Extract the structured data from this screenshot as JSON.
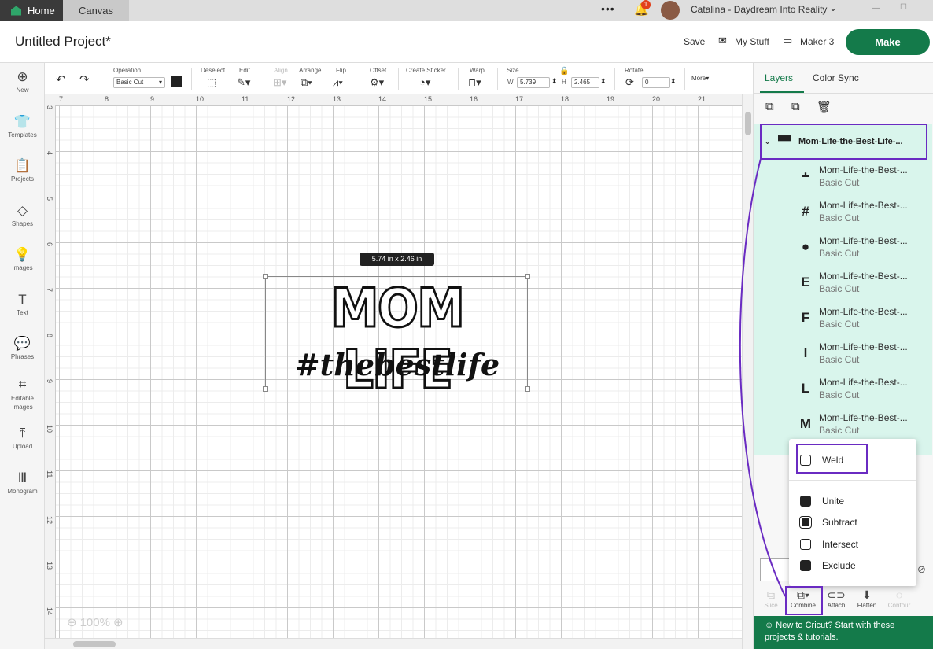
{
  "titlebar": {
    "home_tab": "Home",
    "canvas_tab": "Canvas",
    "more": "•••",
    "notification_count": "1",
    "user_name": "Catalina - Daydream Into Reality"
  },
  "header": {
    "project_title": "Untitled Project*",
    "save": "Save",
    "my_stuff": "My Stuff",
    "machine": "Maker 3",
    "make": "Make"
  },
  "leftbar": [
    {
      "label": "New",
      "icon": "plus-circle-icon"
    },
    {
      "label": "Templates",
      "icon": "shirt-icon"
    },
    {
      "label": "Projects",
      "icon": "clipboard-icon"
    },
    {
      "label": "Shapes",
      "icon": "shapes-icon"
    },
    {
      "label": "Images",
      "icon": "bulb-icon"
    },
    {
      "label": "Text",
      "icon": "text-icon"
    },
    {
      "label": "Phrases",
      "icon": "chat-icon"
    },
    {
      "label": "Editable\nImages",
      "icon": "editable-icon"
    },
    {
      "label": "Upload",
      "icon": "upload-icon"
    },
    {
      "label": "Monogram",
      "icon": "monogram-icon"
    }
  ],
  "toolbar": {
    "operation_label": "Operation",
    "operation_value": "Basic Cut",
    "deselect": "Deselect",
    "edit": "Edit",
    "align": "Align",
    "arrange": "Arrange",
    "flip": "Flip",
    "offset": "Offset",
    "create_sticker": "Create Sticker",
    "warp": "Warp",
    "size": "Size",
    "w_label": "W",
    "w_value": "5.739",
    "h_label": "H",
    "h_value": "2.465",
    "rotate": "Rotate",
    "rotate_value": "0",
    "more": "More"
  },
  "ruler": {
    "top": [
      "7",
      "8",
      "9",
      "10",
      "11",
      "12",
      "13",
      "14",
      "15",
      "16",
      "17",
      "18",
      "19",
      "20",
      "21"
    ],
    "left": [
      "3",
      "4",
      "5",
      "6",
      "7",
      "8",
      "9",
      "10",
      "11",
      "12",
      "13",
      "14"
    ]
  },
  "canvas": {
    "size_tooltip": "5.74  in x 2.46  in",
    "design_line1": "MOM LIFE",
    "design_line2": "#thebestlife",
    "zoom": "100%"
  },
  "rightpanel": {
    "tab_layers": "Layers",
    "tab_color_sync": "Color Sync",
    "group_name": "Mom-Life-the-Best-Life-...",
    "layers": [
      {
        "name": "Mom-Life-the-Best-...",
        "op": "Basic Cut",
        "glyph": "﬩"
      },
      {
        "name": "Mom-Life-the-Best-...",
        "op": "Basic Cut",
        "glyph": "#"
      },
      {
        "name": "Mom-Life-the-Best-...",
        "op": "Basic Cut",
        "glyph": "●"
      },
      {
        "name": "Mom-Life-the-Best-...",
        "op": "Basic Cut",
        "glyph": "E"
      },
      {
        "name": "Mom-Life-the-Best-...",
        "op": "Basic Cut",
        "glyph": "F"
      },
      {
        "name": "Mom-Life-the-Best-...",
        "op": "Basic Cut",
        "glyph": "I"
      },
      {
        "name": "Mom-Life-the-Best-...",
        "op": "Basic Cut",
        "glyph": "L"
      },
      {
        "name": "Mom-Life-the-Best-...",
        "op": "Basic Cut",
        "glyph": "M"
      }
    ],
    "combine_menu": {
      "weld": "Weld",
      "unite": "Unite",
      "subtract": "Subtract",
      "intersect": "Intersect",
      "exclude": "Exclude"
    },
    "bottom": {
      "slice": "Slice",
      "combine": "Combine",
      "attach": "Attach",
      "flatten": "Flatten",
      "contour": "Contour"
    },
    "promo": "New to Cricut? Start with these projects & tutorials."
  },
  "colors": {
    "brand_green": "#147a4a",
    "highlight_purple": "#6a2bc2",
    "layer_bg": "#d9f5ec"
  }
}
